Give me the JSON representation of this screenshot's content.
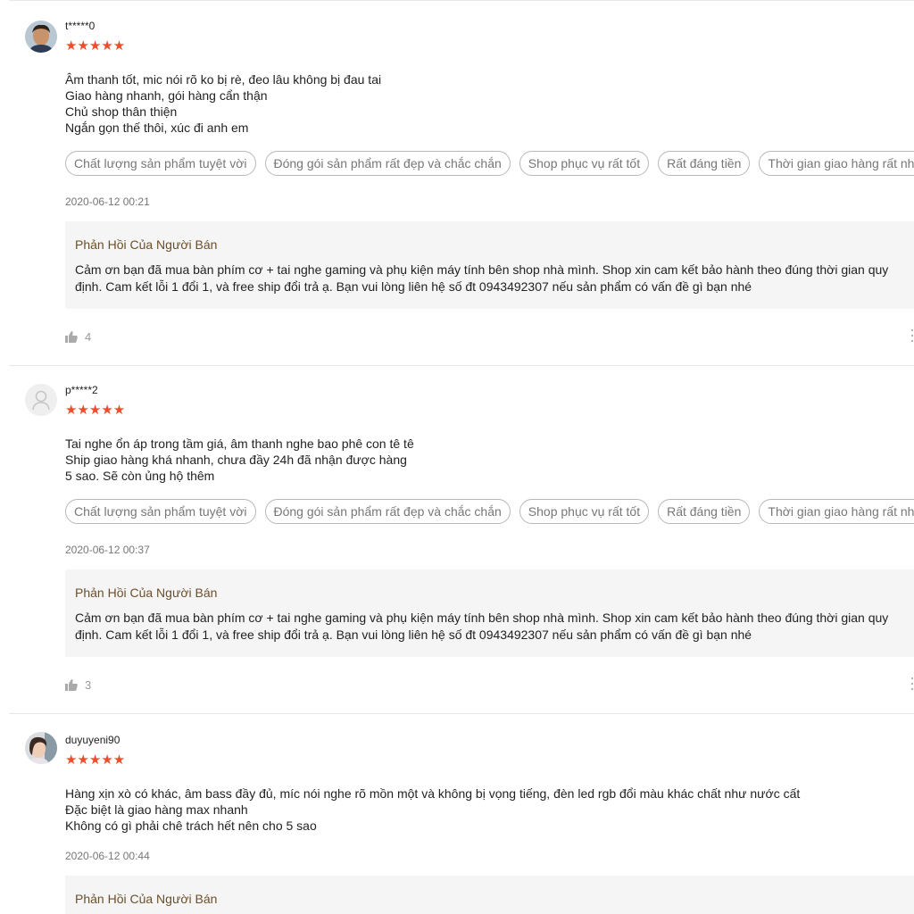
{
  "reviews": [
    {
      "username": "t*****0",
      "stars": "★★★★★",
      "comment": [
        "Âm thanh tốt, mic nói rõ ko bị rè, đeo lâu không bị đau tai",
        "Giao hàng nhanh, gói hàng cẩn thận",
        "Chủ shop thân thiện",
        "Ngắn gọn thế thôi, xúc đi anh em"
      ],
      "tags": [
        "Chất lượng sản phẩm tuyệt vời",
        "Đóng gói sản phẩm rất đẹp và chắc chắn",
        "Shop phục vụ rất tốt",
        "Rất đáng tiền",
        "Thời gian giao hàng rất nhanh"
      ],
      "time": "2020-06-12 00:21",
      "reply_title": "Phản Hồi Của Người Bán",
      "reply_text": "Cảm ơn bạn đã mua bàn phím cơ + tai nghe gaming và phụ kiện máy tính  bên shop nhà mình. Shop xin cam kết bảo hành theo đúng thời gian quy định. Cam kết lỗi 1 đổi 1, và free ship đổi trả ạ. Bạn vui lòng liên hệ số đt 0943492307 nếu sản phẩm có vấn đề gì bạn nhé",
      "likes": "4"
    },
    {
      "username": "p*****2",
      "stars": "★★★★★",
      "comment": [
        "Tai nghe ổn áp trong tầm giá, âm thanh nghe bao phê con tê tê",
        "Ship giao hàng khá nhanh, chưa đầy 24h đã nhận được hàng",
        "5 sao. Sẽ còn ủng hộ thêm"
      ],
      "tags": [
        "Chất lượng sản phẩm tuyệt vời",
        "Đóng gói sản phẩm rất đẹp và chắc chắn",
        "Shop phục vụ rất tốt",
        "Rất đáng tiền",
        "Thời gian giao hàng rất nhanh"
      ],
      "time": "2020-06-12 00:37",
      "reply_title": "Phản Hồi Của Người Bán",
      "reply_text": "Cảm ơn bạn đã mua bàn phím cơ + tai nghe gaming và phụ kiện máy tính  bên shop nhà mình. Shop xin cam kết bảo hành theo đúng thời gian quy định. Cam kết lỗi 1 đổi 1, và free ship đổi trả ạ. Bạn vui lòng liên hệ số đt 0943492307 nếu sản phẩm có vấn đề gì bạn nhé",
      "likes": "3"
    },
    {
      "username": "duyuyeni90",
      "stars": "★★★★★",
      "comment": [
        "Hàng xịn xò có khác, âm bass đầy đủ, míc nói nghe rõ mồn một và không bị vọng tiếng, đèn led rgb đổi màu khác chất như nước cất",
        "Đặc biệt là giao hàng max nhanh",
        "Không có gì phải chê trách hết nên cho 5 sao"
      ],
      "time": "2020-06-12 00:44",
      "reply_title": "Phản Hồi Của Người Bán"
    }
  ],
  "colors": {
    "star": "#ee4d2d",
    "reply_title": "#6b4f2a",
    "reply_bg": "#f5f5f5"
  }
}
